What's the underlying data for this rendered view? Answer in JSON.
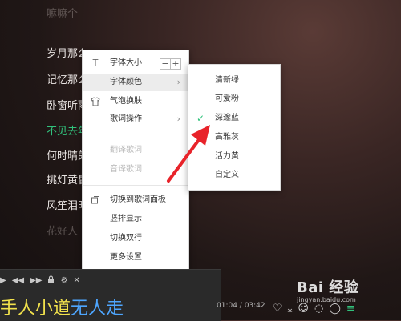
{
  "lyrics": {
    "l0": "嘛嘛个",
    "l1": "岁月那么",
    "l2": "记忆那么",
    "l3": "卧窗听雨",
    "l4": "不见去年",
    "l5": "何时晴朗",
    "l6": "挑灯黄昏",
    "l7": "风笙泪时",
    "l8": "花好人"
  },
  "context_menu": {
    "font_size": "字体大小",
    "stepper_minus": "−",
    "stepper_plus": "+",
    "font_color": "字体颜色",
    "bubble_skin": "气泡换肤",
    "lyric_ops": "歌词操作",
    "translate": "翻译歌词",
    "transliterate": "音译歌词",
    "switch_panel": "切换到歌词面板",
    "vertical": "竖排显示",
    "dual_line": "切换双行",
    "more_settings": "更多设置"
  },
  "color_submenu": {
    "items": [
      "清新绿",
      "可爱粉",
      "深邃蓝",
      "高雅灰",
      "活力黄",
      "自定义"
    ],
    "selected": "深邃蓝",
    "check": "✓"
  },
  "player": {
    "lyric_sung": "手人小道",
    "lyric_rest": "无人走",
    "time": "01:04 / 03:42"
  },
  "watermark": {
    "logo": "Bai 经验",
    "url": "jingyan.baidu.com"
  },
  "colors": {
    "accent_green": "#31c27c",
    "lyric_yellow": "#f2e24c",
    "lyric_blue": "#4ea6ff",
    "annotation_red": "#e8232a"
  }
}
